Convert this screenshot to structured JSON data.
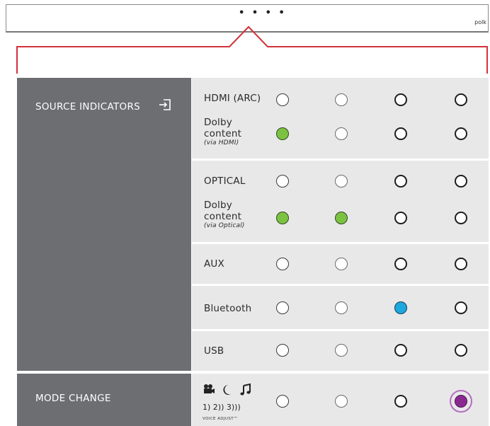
{
  "soundbar": {
    "dots": "• • • •",
    "brand": "polk"
  },
  "sections": {
    "source_title": "SOURCE INDICATORS",
    "mode_title": "MODE CHANGE"
  },
  "rows": {
    "hdmi": {
      "label": "HDMI (ARC)"
    },
    "dolby_hdmi": {
      "line1": "Dolby",
      "line2": "content",
      "note": "(via HDMI)"
    },
    "optical": {
      "label": "OPTICAL"
    },
    "dolby_optical": {
      "line1": "Dolby",
      "line2": "content",
      "note": "(via Optical)"
    },
    "aux": {
      "label": "AUX"
    },
    "bluetooth": {
      "label": "Bluetooth"
    },
    "usb": {
      "label": "USB"
    }
  },
  "mode": {
    "voice_levels": "1)   2))   3)))",
    "voice_label": "VOICE ADJUST™"
  },
  "colors": {
    "panel_dark": "#6d6e71",
    "panel_light": "#e8e8e9",
    "callout_red": "#d2333a",
    "led_green": "#7cc242",
    "led_blue": "#1ea8e0",
    "led_purple": "#8a2a91"
  },
  "led_states": {
    "hdmi": [
      "off",
      "off",
      "off",
      "off"
    ],
    "dolby_hdmi": [
      "green",
      "off",
      "off",
      "off"
    ],
    "optical": [
      "off",
      "off",
      "off",
      "off"
    ],
    "dolby_optical": [
      "green",
      "green",
      "off",
      "off"
    ],
    "aux": [
      "off",
      "off",
      "off",
      "off"
    ],
    "bluetooth": [
      "off",
      "off",
      "blue",
      "off"
    ],
    "usb": [
      "off",
      "off",
      "off",
      "off"
    ],
    "mode": [
      "off",
      "off",
      "off",
      "purple-glow"
    ]
  }
}
